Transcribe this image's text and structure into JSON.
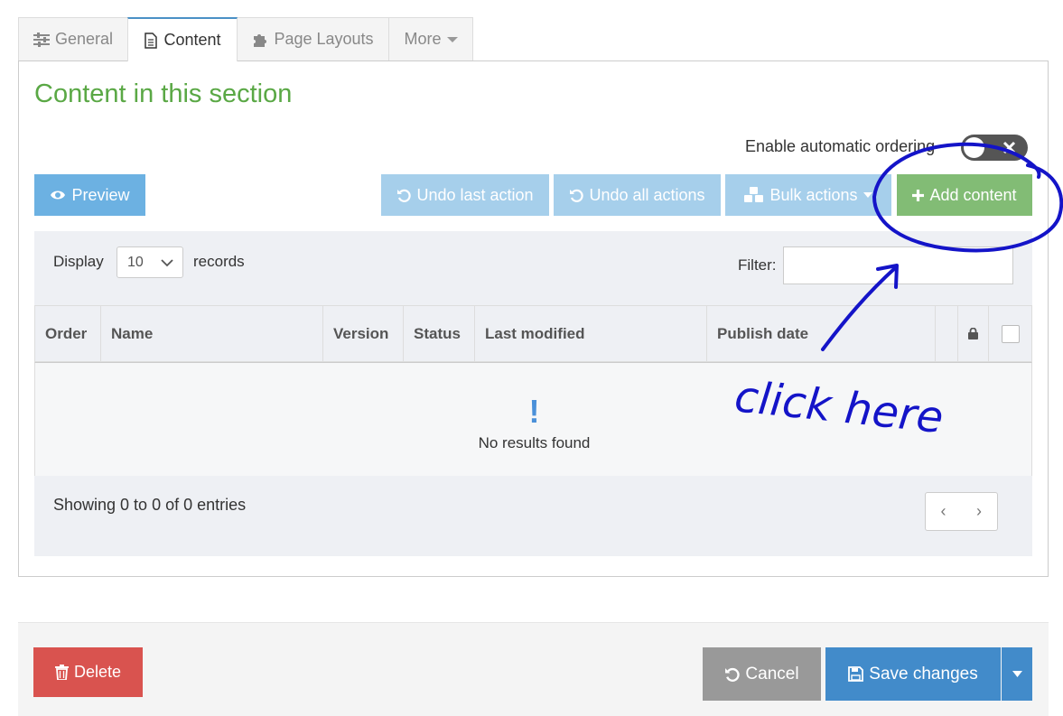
{
  "tabs": {
    "general": "General",
    "content": "Content",
    "page_layouts": "Page Layouts",
    "more": "More"
  },
  "section_title": "Content in this section",
  "auto_ordering_label": "Enable automatic ordering",
  "buttons": {
    "preview": "Preview",
    "undo_last": "Undo last action",
    "undo_all": "Undo all actions",
    "bulk_actions": "Bulk actions",
    "add_content": "Add content",
    "delete": "Delete",
    "cancel": "Cancel",
    "save_changes": "Save changes"
  },
  "records": {
    "display_label": "Display",
    "count_value": "10",
    "records_label": "records",
    "filter_label": "Filter:",
    "filter_value": ""
  },
  "table": {
    "columns": [
      "Order",
      "Name",
      "Version",
      "Status",
      "Last modified",
      "Publish date"
    ],
    "empty_icon_glyph": "!",
    "empty_message": "No results found",
    "summary": "Showing 0 to 0 of 0 entries",
    "prev": "‹",
    "next": "›"
  },
  "annotation": {
    "text": "click here"
  },
  "colors": {
    "title_green": "#5aa845",
    "preview_blue": "#6cb1e2",
    "disabled_blue": "#a6cfeb",
    "add_green": "#82bc75",
    "delete_red": "#d9534f",
    "cancel_gray": "#999999",
    "save_blue": "#428bca",
    "annotation_ink": "#1414c8"
  }
}
